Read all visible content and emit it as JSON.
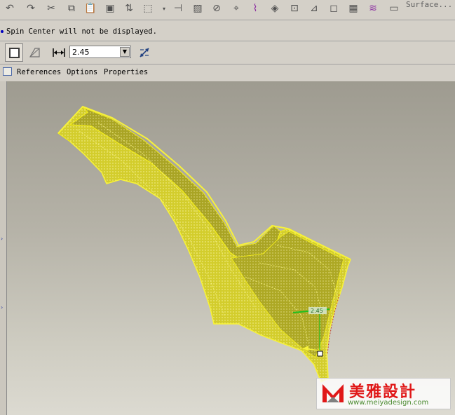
{
  "toolbar": {
    "icons": [
      "undo-icon",
      "redo-icon",
      "cut-icon",
      "copy-icon",
      "paste-icon",
      "paste-special-icon",
      "regenerate-icon",
      "selection-box-icon",
      "mirror-icon",
      "hatch-icon",
      "revolve-icon",
      "sweep-icon",
      "spring-icon",
      "blend-icon",
      "hole-icon",
      "draft-icon",
      "shell-icon",
      "pattern-icon",
      "surface-icon"
    ],
    "surface_label": "Surface..."
  },
  "message": {
    "text": "Spin Center will not be displayed."
  },
  "dashboard": {
    "thickness_value": "2.45"
  },
  "tabs": {
    "references": "References",
    "options": "Options",
    "properties": "Properties"
  },
  "model": {
    "dimension_label": "2.45",
    "fill_color": "#d8d22a",
    "edge_color": "#f2ec1c"
  },
  "watermark": {
    "name": "美雅設計",
    "url": "www.meiyadesign.com"
  }
}
